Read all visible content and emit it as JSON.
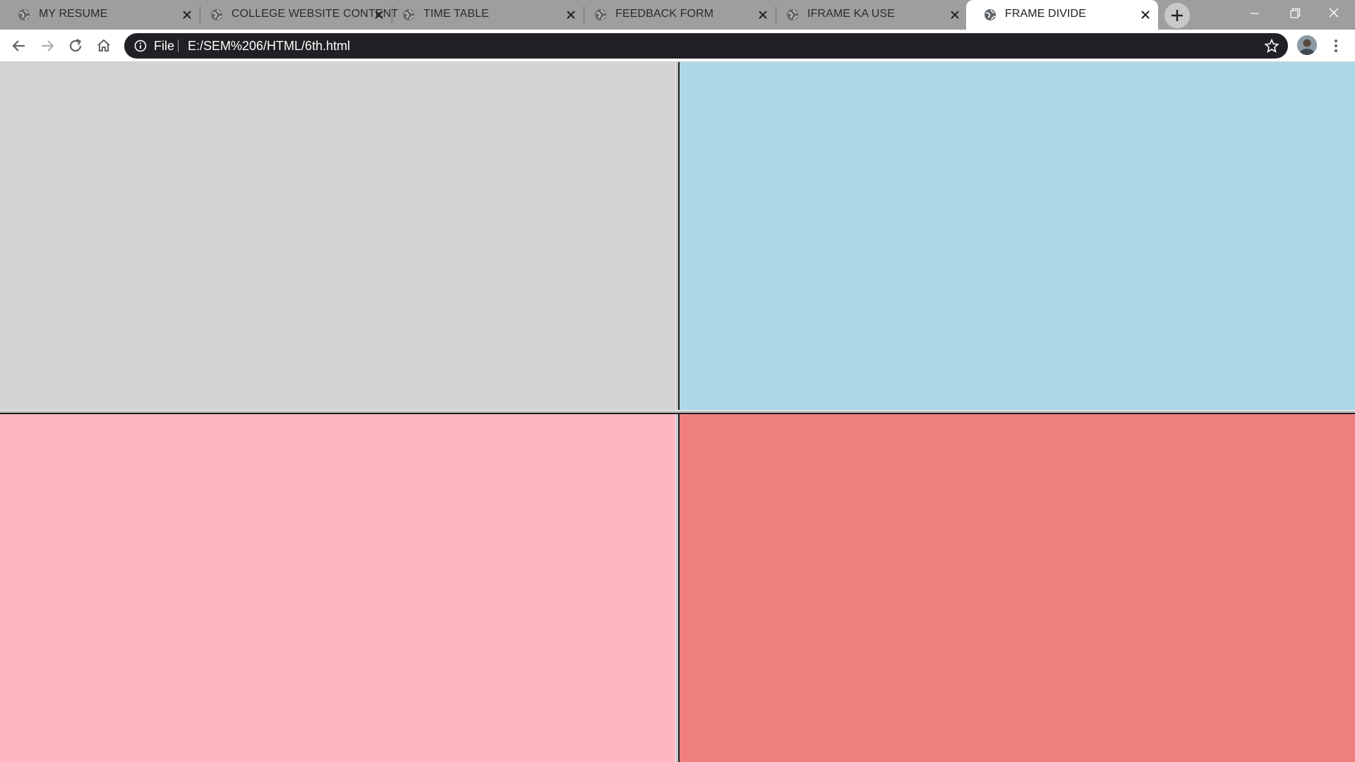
{
  "tabs": [
    {
      "title": "MY RESUME",
      "active": false
    },
    {
      "title": "COLLEGE WEBSITE CONTENT",
      "active": false
    },
    {
      "title": "TIME TABLE",
      "active": false
    },
    {
      "title": "FEEDBACK FORM",
      "active": false
    },
    {
      "title": "IFRAME KA USE",
      "active": false
    },
    {
      "title": "FRAME DIVIDE",
      "active": true
    }
  ],
  "omnibox": {
    "scheme_label": "File",
    "url": "E:/SEM%206/HTML/6th.html"
  },
  "frames": {
    "top_left": {
      "color": "#d3d3d3"
    },
    "top_right": {
      "color": "#add8e6"
    },
    "bottom_left": {
      "color": "#ffb6c1"
    },
    "bottom_right": {
      "color": "#f08080"
    }
  }
}
